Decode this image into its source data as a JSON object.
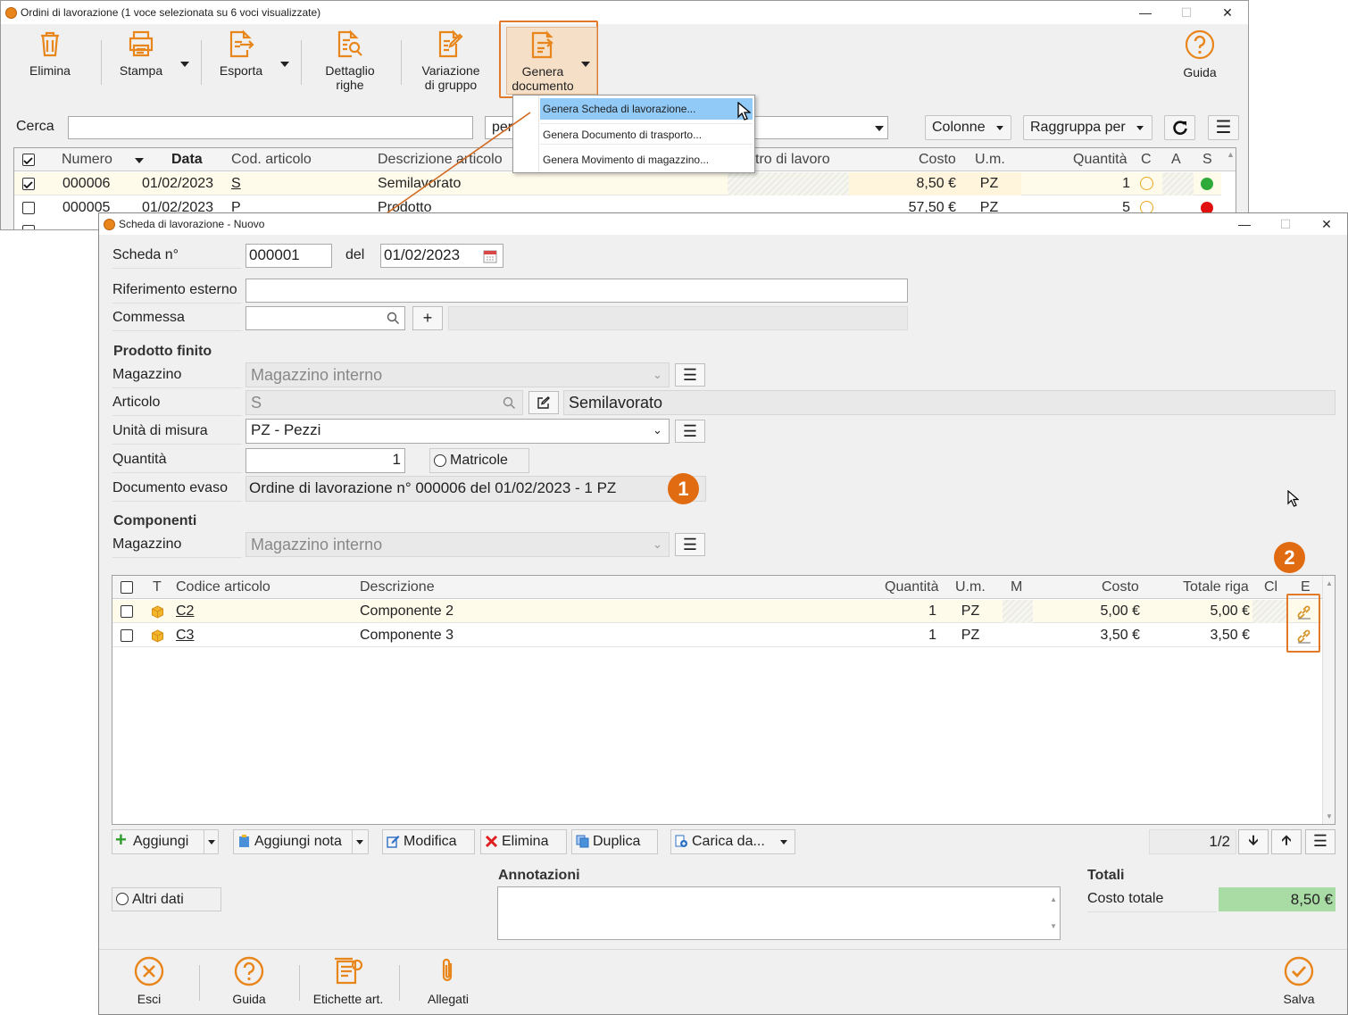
{
  "back_window": {
    "title": "Ordini di lavorazione (1 voce selezionata su 6 voci visualizzate)",
    "toolbar": {
      "elimina": "Elimina",
      "stampa": "Stampa",
      "esporta": "Esporta",
      "dettaglio_l1": "Dettaglio",
      "dettaglio_l2": "righe",
      "variazione_l1": "Variazione",
      "variazione_l2": "di gruppo",
      "genera_l1": "Genera",
      "genera_l2": "documento",
      "guida": "Guida"
    },
    "search": {
      "label": "Cerca",
      "value": "",
      "per_label": "per",
      "colonne": "Colonne",
      "raggruppa": "Raggruppa per"
    },
    "menu": {
      "items": [
        "Genera Scheda di lavorazione...",
        "Genera Documento di trasporto...",
        "Genera Movimento di magazzino..."
      ]
    },
    "grid": {
      "headers": {
        "numero": "Numero",
        "data": "Data",
        "cod": "Cod. articolo",
        "descr": "Descrizione articolo",
        "centro": "tro di lavoro",
        "costo": "Costo",
        "um": "U.m.",
        "qta": "Quantità",
        "c": "C",
        "a": "A",
        "s": "S"
      },
      "rows": [
        {
          "numero": "000006",
          "data": "01/02/2023",
          "cod": "S",
          "descr": "Semilavorato",
          "costo": "8,50 €",
          "um": "PZ",
          "qta": "1",
          "checked": true,
          "status": "#2eaa3a"
        },
        {
          "numero": "000005",
          "data": "01/02/2023",
          "cod": "P",
          "descr": "Prodotto",
          "costo": "57,50 €",
          "um": "PZ",
          "qta": "5",
          "checked": false,
          "status": "#e01010"
        }
      ]
    }
  },
  "front_window": {
    "title": "Scheda di lavorazione - Nuovo",
    "scheda_label": "Scheda n°",
    "scheda_value": "000001",
    "del_label": "del",
    "date_value": "01/02/2023",
    "rif_label": "Riferimento esterno",
    "rif_value": "",
    "commessa_label": "Commessa",
    "commessa_value": "",
    "prodotto_title": "Prodotto finito",
    "magazzino_label": "Magazzino",
    "magazzino_value": "Magazzino interno",
    "articolo_label": "Articolo",
    "articolo_value": "S",
    "articolo_desc": "Semilavorato",
    "um_label": "Unità di misura",
    "um_value": "PZ - Pezzi",
    "qta_label": "Quantità",
    "qta_value": "1",
    "matricole_label": "Matricole",
    "doc_label": "Documento evaso",
    "doc_value": "Ordine di lavorazione n° 000006 del 01/02/2023 - 1 PZ",
    "badge1": "1",
    "badge2": "2",
    "componenti_title": "Componenti",
    "comp_magazzino_label": "Magazzino",
    "comp_magazzino_value": "Magazzino interno",
    "grid": {
      "headers": {
        "t": "T",
        "codice": "Codice articolo",
        "descr": "Descrizione",
        "qta": "Quantità",
        "um": "U.m.",
        "m": "M",
        "costo": "Costo",
        "totale": "Totale riga",
        "cl": "Cl",
        "e": "E"
      },
      "rows": [
        {
          "codice": "C2",
          "descr": "Componente 2",
          "qta": "1",
          "um": "PZ",
          "costo": "5,00 €",
          "totale": "5,00 €"
        },
        {
          "codice": "C3",
          "descr": "Componente 3",
          "qta": "1",
          "um": "PZ",
          "costo": "3,50 €",
          "totale": "3,50 €"
        }
      ]
    },
    "grid_buttons": {
      "aggiungi": "Aggiungi",
      "aggiungi_nota": "Aggiungi nota",
      "modifica": "Modifica",
      "elimina": "Elimina",
      "duplica": "Duplica",
      "carica": "Carica da...",
      "page": "1/2"
    },
    "altri_dati": "Altri dati",
    "annotazioni_title": "Annotazioni",
    "annotazioni_value": "",
    "totali_title": "Totali",
    "costo_totale_label": "Costo totale",
    "costo_totale_value": "8,50 €",
    "footer": {
      "esci": "Esci",
      "guida": "Guida",
      "etichette": "Etichette art.",
      "allegati": "Allegati",
      "salva": "Salva"
    }
  },
  "colors": {
    "accent": "#e8861c",
    "highlight_border": "#e07a2a",
    "menu_selected": "#91c9f7",
    "total_bg": "#a9dca5"
  }
}
